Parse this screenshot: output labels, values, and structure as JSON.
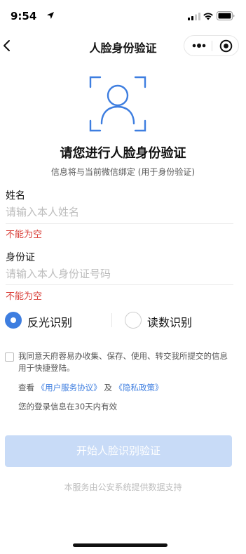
{
  "status_bar": {
    "time": "9:54"
  },
  "nav": {
    "title": "人脸身份验证"
  },
  "intro": {
    "heading": "请您进行人脸身份验证",
    "subheading": "信息将与当前微信绑定 (用于身份验证)"
  },
  "form": {
    "name": {
      "label": "姓名",
      "placeholder": "请输入本人姓名",
      "value": "",
      "error": "不能为空"
    },
    "id_card": {
      "label": "身份证",
      "placeholder": "请输入本人身份证号码",
      "value": "",
      "error": "不能为空"
    }
  },
  "recognition_mode": {
    "options": [
      {
        "label": "反光识别",
        "selected": true
      },
      {
        "label": "读数识别",
        "selected": false
      }
    ]
  },
  "agreement": {
    "checked": false,
    "text": "我同意天府蓉易办收集、保存、使用、转交我所提交的信息用于快捷登陆。",
    "view_prefix": "查看",
    "link_user_agreement": "《用户服务协议》",
    "and_text": "及",
    "link_privacy": "《隐私政策》",
    "validity_text": "您的登录信息在30天内有效"
  },
  "start_button": {
    "label": "开始人脸识别验证"
  },
  "footer": {
    "note": "本服务由公安系统提供数据支持"
  },
  "colors": {
    "accent": "#3e7ee0",
    "button_disabled": "#c8dbf7",
    "error": "#d9403a",
    "placeholder": "#bdbdbd"
  },
  "icons": [
    "location-arrow-icon",
    "signal-icon",
    "wifi-icon",
    "battery-icon",
    "back-icon",
    "more-icon",
    "close-miniprogram-icon",
    "face-scan-icon"
  ]
}
